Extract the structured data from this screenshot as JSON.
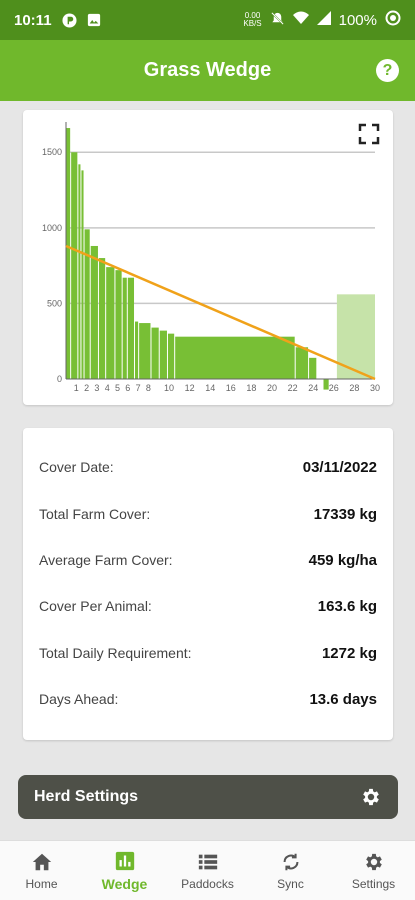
{
  "status_bar": {
    "time": "10:11",
    "data_rate_top": "0.00",
    "data_rate_bottom": "KB/S",
    "battery": "100%"
  },
  "app_bar": {
    "title": "Grass Wedge",
    "help_label": "?"
  },
  "chart_data": {
    "type": "bar",
    "title": "",
    "xlabel": "",
    "ylabel": "",
    "ylim": [
      0,
      1700
    ],
    "xlim": [
      0,
      30
    ],
    "yticks": [
      "0",
      "500",
      "1000",
      "1500"
    ],
    "xticks": [
      "1",
      "2",
      "3",
      "4",
      "5",
      "6",
      "7",
      "8",
      "10",
      "12",
      "14",
      "16",
      "18",
      "20",
      "22",
      "24",
      "26",
      "28",
      "30"
    ],
    "xtick_values": [
      1,
      2,
      3,
      4,
      5,
      6,
      7,
      8,
      10,
      12,
      14,
      16,
      18,
      20,
      22,
      24,
      26,
      28,
      30
    ],
    "grid": true,
    "bars": [
      {
        "start": 0.0,
        "end": 0.5,
        "value": 1660
      },
      {
        "start": 0.5,
        "end": 1.2,
        "value": 1500
      },
      {
        "start": 1.2,
        "end": 1.5,
        "value": 1420
      },
      {
        "start": 1.5,
        "end": 1.8,
        "value": 1380
      },
      {
        "start": 1.8,
        "end": 2.4,
        "value": 990
      },
      {
        "start": 2.4,
        "end": 3.2,
        "value": 880
      },
      {
        "start": 3.2,
        "end": 3.9,
        "value": 800
      },
      {
        "start": 3.9,
        "end": 4.8,
        "value": 740
      },
      {
        "start": 4.8,
        "end": 5.5,
        "value": 720
      },
      {
        "start": 5.5,
        "end": 6.0,
        "value": 670
      },
      {
        "start": 6.0,
        "end": 6.7,
        "value": 670
      },
      {
        "start": 6.7,
        "end": 7.1,
        "value": 380
      },
      {
        "start": 7.1,
        "end": 8.3,
        "value": 370
      },
      {
        "start": 8.3,
        "end": 9.1,
        "value": 340
      },
      {
        "start": 9.1,
        "end": 9.9,
        "value": 320
      },
      {
        "start": 9.9,
        "end": 10.6,
        "value": 300
      },
      {
        "start": 10.6,
        "end": 22.3,
        "value": 280
      },
      {
        "start": 22.3,
        "end": 23.6,
        "value": 210
      },
      {
        "start": 23.6,
        "end": 24.4,
        "value": 140
      },
      {
        "start": 25.0,
        "end": 25.6,
        "value": -70
      }
    ],
    "target_bar": {
      "start": 26.3,
      "end": 30.0,
      "value": 560
    },
    "target_line": {
      "x": [
        0,
        30
      ],
      "y": [
        880,
        0
      ]
    },
    "colors": {
      "bar": "#78bf35",
      "target_bar": "#c6e3a9",
      "line": "#f0a21a",
      "grid": "#c8c8c8",
      "axis": "#666666"
    }
  },
  "summary": {
    "rows": [
      {
        "label": "Cover Date:",
        "value": "03/11/2022"
      },
      {
        "label": "Total Farm Cover:",
        "value": "17339 kg"
      },
      {
        "label": "Average Farm Cover:",
        "value": "459 kg/ha"
      },
      {
        "label": "Cover Per Animal:",
        "value": "163.6 kg"
      },
      {
        "label": "Total Daily Requirement:",
        "value": "1272 kg"
      },
      {
        "label": "Days Ahead:",
        "value": "13.6 days"
      }
    ]
  },
  "herd_settings": {
    "label": "Herd Settings",
    "icon": "gear-icon"
  },
  "nav": {
    "items": [
      {
        "label": "Home",
        "icon": "home-icon"
      },
      {
        "label": "Wedge",
        "icon": "bar-chart-icon"
      },
      {
        "label": "Paddocks",
        "icon": "list-icon"
      },
      {
        "label": "Sync",
        "icon": "sync-icon"
      },
      {
        "label": "Settings",
        "icon": "gear-icon"
      }
    ],
    "active": "Wedge"
  },
  "colors": {
    "status_bar": "#4f8f1c",
    "app_bar": "#70b82c",
    "accent": "#70b82c",
    "herd_button": "#4e5048",
    "background": "#e6e6e6"
  }
}
